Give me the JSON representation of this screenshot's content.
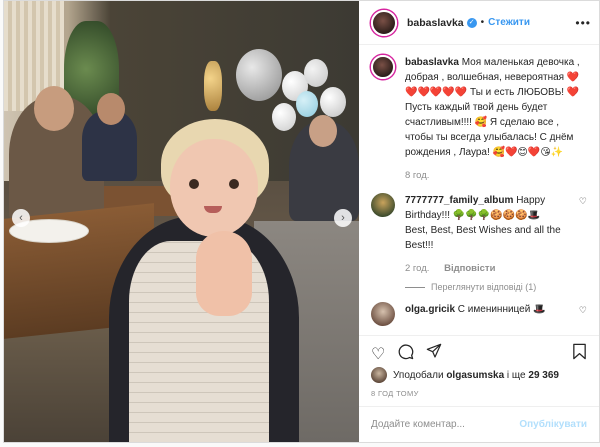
{
  "post": {
    "username": "babaslavka",
    "follow_label": "Стежити",
    "caption_user": "babaslavka",
    "caption_text": "Моя маленькая девочка , добрая , волшебная, невероятная ❤️❤️❤️❤️❤️❤️ Ты и есть ЛЮБОВЬ! ❤️ Пусть каждый твой день будет счастливым!!!! 🥰 Я сделаю все , чтобы ты всегда улыбалась! С днём рождения , Лаура! 🥰❤️😊❤️😘✨",
    "caption_age": "8 год."
  },
  "comments": [
    {
      "user": "7777777_family_album",
      "text": "Happy Birthday!!! 🌳🌳🌳🍪🍪🍪🎩 Best, Best, Best Wishes and all the Best!!!",
      "age": "2 год.",
      "reply_label": "Відповісти",
      "view_replies": "Переглянути відповіді (1)"
    },
    {
      "user": "olga.gricik",
      "text": "С именинницей 🎩"
    }
  ],
  "likes": {
    "prefix": "Уподобали",
    "user": "olgasumska",
    "suffix": "і ще",
    "count": "29 369"
  },
  "timestamp": "8 ГОД ТОМУ",
  "comment_box": {
    "placeholder": "Додайте коментар...",
    "publish_label": "Опублікувати"
  },
  "icons": {
    "like": "heart-icon",
    "comment": "comment-icon",
    "share": "share-icon",
    "save": "bookmark-icon",
    "more": "more-options-icon",
    "prev": "chevron-left-icon",
    "next": "chevron-right-icon"
  },
  "colors": {
    "accent": "#3897f0",
    "heart": "#ed4956",
    "muted": "#8e8e8e"
  }
}
